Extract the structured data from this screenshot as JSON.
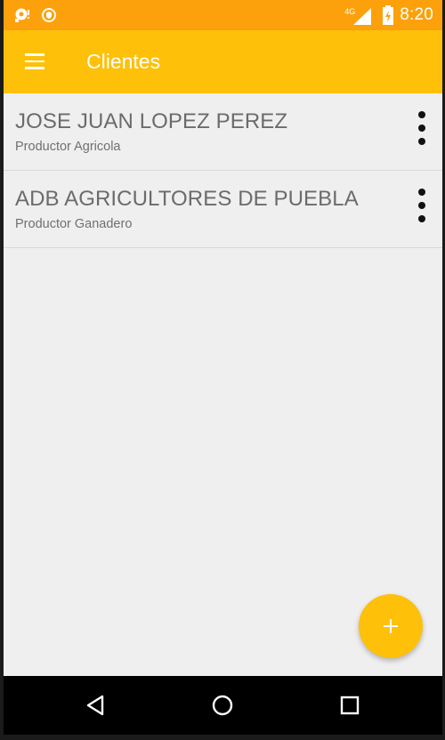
{
  "status_bar": {
    "network": "4G",
    "time": "8:20",
    "left_icons": [
      "notification-icon",
      "shield-icon"
    ],
    "right_icons": [
      "signal-icon",
      "battery-icon"
    ]
  },
  "app_bar": {
    "title": "Clientes",
    "menu_icon": "menu-icon"
  },
  "clients": [
    {
      "name": "JOSE JUAN LOPEZ PEREZ",
      "type": "Productor Agricola"
    },
    {
      "name": "ADB AGRICULTORES DE PUEBLA",
      "type": "Productor Ganadero"
    }
  ],
  "fab": {
    "icon": "add-icon"
  },
  "nav_bar": {
    "icons": [
      "back-icon",
      "home-icon",
      "recents-icon"
    ]
  },
  "colors": {
    "status_bar": "#fca10c",
    "app_bar": "#fec009",
    "background": "#efefef",
    "fab": "#fec009"
  }
}
